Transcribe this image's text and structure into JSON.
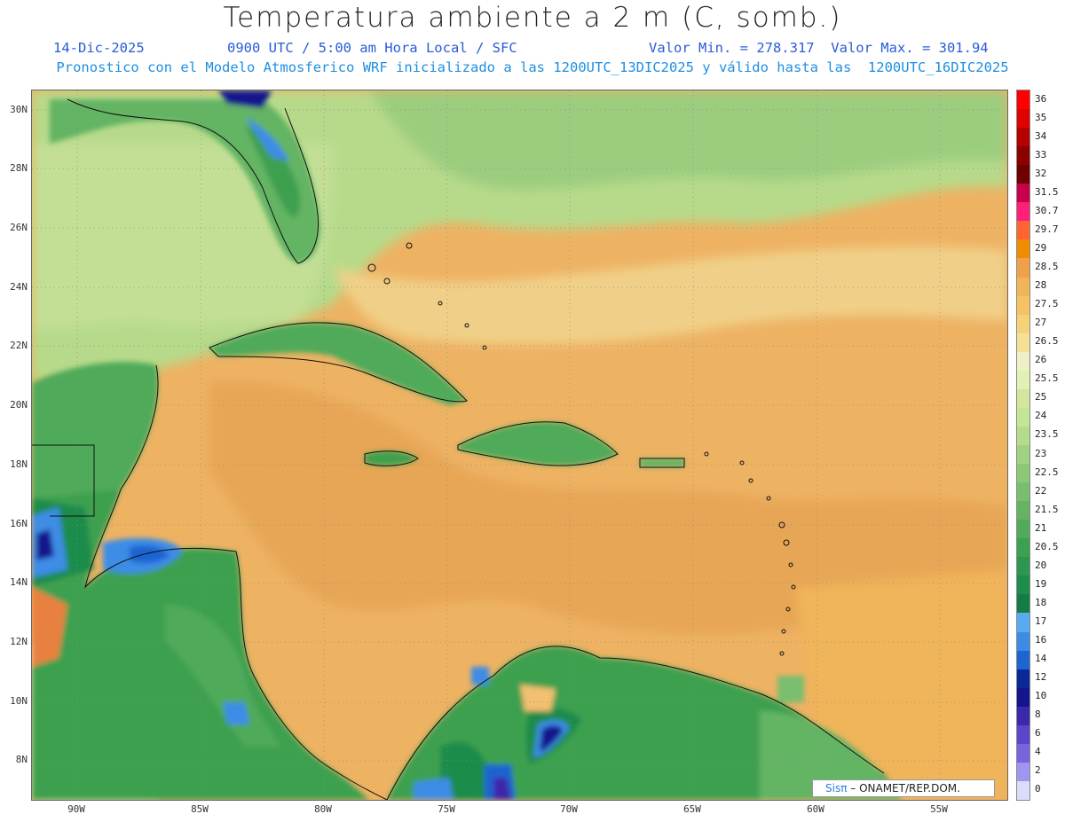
{
  "title": "Temperatura ambiente a 2 m (C, somb.)",
  "subtitle": {
    "date": "14-Dic-2025",
    "time": "0900 UTC / 5:00 am Hora Local / SFC",
    "minmax": "Valor Min. = 278.317  Valor Max. = 301.94",
    "model": "Pronostico con el Modelo Atmosferico WRF inicializado a las 1200UTC_13DIC2025 y válido hasta las  1200UTC_16DIC2025"
  },
  "lat_labels": [
    "30N",
    "28N",
    "26N",
    "24N",
    "22N",
    "20N",
    "18N",
    "16N",
    "14N",
    "12N",
    "10N",
    "8N"
  ],
  "lon_labels": [
    "90W",
    "85W",
    "80W",
    "75W",
    "70W",
    "65W",
    "60W",
    "55W"
  ],
  "legend": {
    "labels": [
      "36",
      "35",
      "34",
      "33",
      "32",
      "31.5",
      "30.7",
      "29.7",
      "29",
      "28.5",
      "28",
      "27.5",
      "27",
      "26.5",
      "26",
      "25.5",
      "25",
      "24",
      "23.5",
      "23",
      "22.5",
      "22",
      "21.5",
      "21",
      "20.5",
      "20",
      "19",
      "18",
      "17",
      "16",
      "14",
      "12",
      "10",
      "8",
      "6",
      "4",
      "2",
      "0"
    ],
    "colors": [
      "#ff0000",
      "#e10000",
      "#b40000",
      "#8c0000",
      "#6e0000",
      "#c8004b",
      "#ff1e78",
      "#ff6432",
      "#f08c00",
      "#f0a04b",
      "#f0b45a",
      "#f5c364",
      "#f5d278",
      "#f5e196",
      "#f0f0c8",
      "#e1f0b4",
      "#d2e6a0",
      "#c3e696",
      "#b4dc8c",
      "#a0d282",
      "#8cc878",
      "#78be6e",
      "#64b464",
      "#50aa5a",
      "#3ca050",
      "#2d9650",
      "#1e8c4b",
      "#147d46",
      "#5aaaf0",
      "#3c8ce6",
      "#1e64d2",
      "#0a2896",
      "#14148c",
      "#3c28aa",
      "#5a46c8",
      "#7864dc",
      "#a096f0",
      "#dcdcfa"
    ]
  },
  "credit": {
    "logo": "Sisπ",
    "text": " – ONAMET/REP.DOM."
  }
}
